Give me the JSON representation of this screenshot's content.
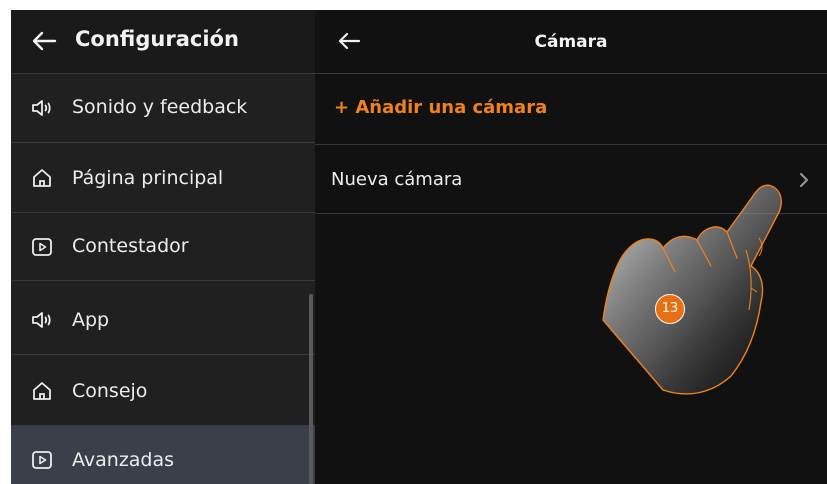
{
  "left_panel": {
    "title": "Configuración",
    "items": [
      {
        "label": "Sonido y feedback",
        "icon": "speaker-icon"
      },
      {
        "label": "Página principal",
        "icon": "home-icon"
      },
      {
        "label": "Contestador",
        "icon": "play-box-icon"
      },
      {
        "label": "App",
        "icon": "speaker-icon"
      },
      {
        "label": "Consejo",
        "icon": "home-icon"
      },
      {
        "label": "Avanzadas",
        "icon": "play-box-icon",
        "selected": true
      }
    ]
  },
  "right_panel": {
    "title": "Cámara",
    "add_label": "+ Añadir una cámara",
    "camera_item": "Nueva cámara"
  },
  "annotation": {
    "step": "13",
    "pointer_icon": "hand-pointer-icon"
  },
  "colors": {
    "accent": "#f0821e",
    "selected_row": "#3a3f49",
    "background": "#111111",
    "left_panel_bg": "#202020"
  }
}
